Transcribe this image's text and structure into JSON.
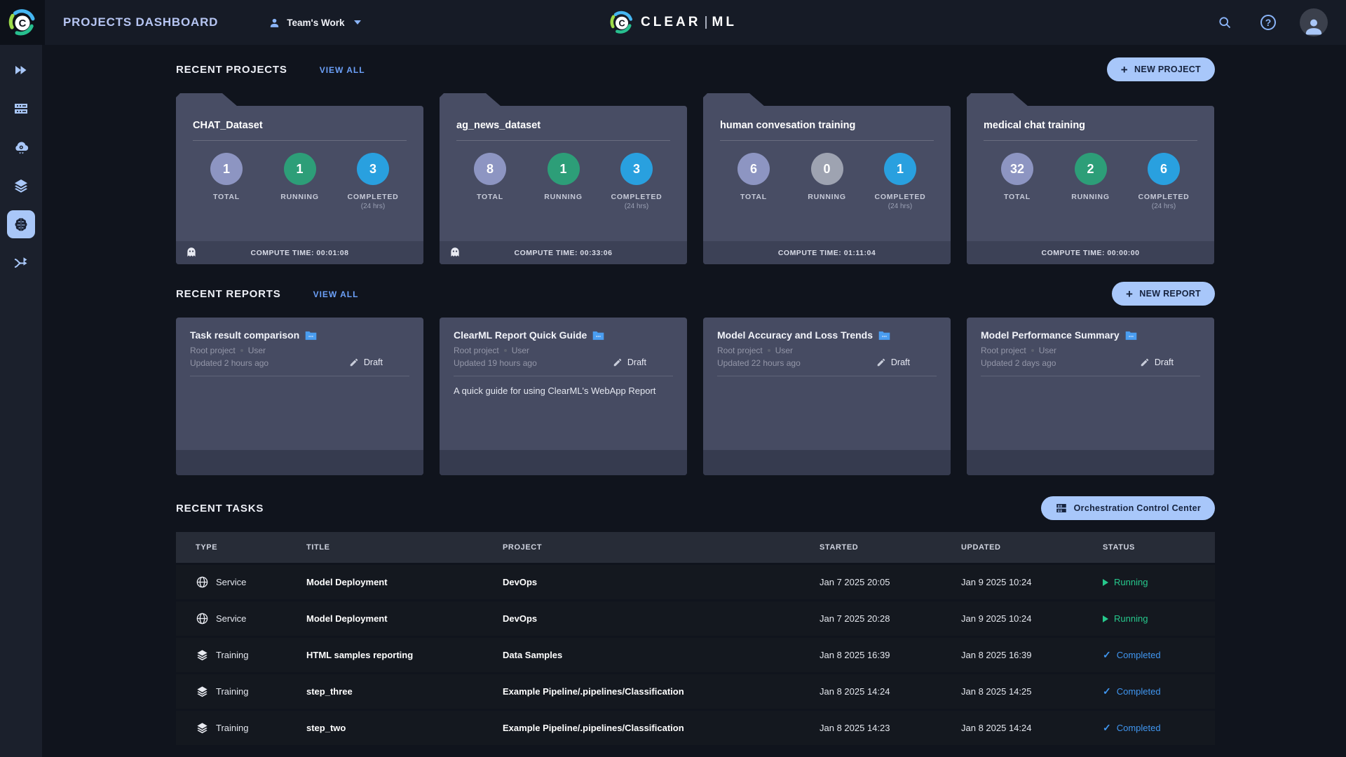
{
  "colors": {
    "accent_blue": "#a8c7fa",
    "link_blue": "#6ca0f8",
    "running_green": "#26c88c",
    "completed_blue": "#4096f0",
    "circle_total": "#8d95c2",
    "circle_running": "#2d9e78",
    "circle_completed": "#29a0df",
    "circle_zero": "#9ea3b1",
    "card_bg": "#484d64",
    "card_footer_bg": "#3c4156",
    "header_bg": "#161b26",
    "page_bg": "#10141d"
  },
  "header": {
    "page_title": "PROJECTS DASHBOARD",
    "workspace_label": "Team's Work",
    "brand_left": "CLEAR",
    "brand_right": "ML"
  },
  "icons": {
    "header": [
      "clearml-logo-icon",
      "user-icon",
      "chevron-down-icon",
      "search-icon",
      "help-icon",
      "profile-icon"
    ],
    "sidebar": [
      "getting-started-icon",
      "workers-queues-icon",
      "cloud-autoscaler-icon",
      "datasets-icon",
      "projects-brain-icon",
      "pipelines-icon"
    ],
    "misc": [
      "folder-tab",
      "ghost-icon",
      "report-folder-icon",
      "pencil-icon",
      "plus-icon",
      "globe-icon",
      "layers-icon",
      "play-icon",
      "check-icon",
      "server-icon"
    ]
  },
  "recent_projects": {
    "title": "RECENT PROJECTS",
    "view_all": "VIEW ALL",
    "new_button": "NEW PROJECT",
    "stats_labels": {
      "total": "TOTAL",
      "running": "RUNNING",
      "completed": "COMPLETED",
      "completed_sub": "(24 hrs)"
    },
    "cards": [
      {
        "name": "CHAT_Dataset",
        "total": "1",
        "running": "1",
        "completed": "3",
        "compute_time": "COMPUTE TIME: 00:01:08",
        "ghost": true
      },
      {
        "name": "ag_news_dataset",
        "total": "8",
        "running": "1",
        "completed": "3",
        "compute_time": "COMPUTE TIME: 00:33:06",
        "ghost": true
      },
      {
        "name": "human convesation training",
        "total": "6",
        "running": "0",
        "completed": "1",
        "compute_time": "COMPUTE TIME: 01:11:04",
        "ghost": false
      },
      {
        "name": "medical chat training",
        "total": "32",
        "running": "2",
        "completed": "6",
        "compute_time": "COMPUTE TIME: 00:00:00",
        "ghost": false
      }
    ]
  },
  "recent_reports": {
    "title": "RECENT REPORTS",
    "view_all": "VIEW ALL",
    "new_button": "NEW REPORT",
    "cards": [
      {
        "title": "Task result comparison",
        "project": "Root project",
        "author": "User",
        "updated": "Updated 2 hours ago",
        "status": "Draft",
        "description": ""
      },
      {
        "title": "ClearML Report Quick Guide",
        "project": "Root project",
        "author": "User",
        "updated": "Updated 19 hours ago",
        "status": "Draft",
        "description": "A quick guide for using ClearML's WebApp Report"
      },
      {
        "title": "Model Accuracy and Loss Trends",
        "project": "Root project",
        "author": "User",
        "updated": "Updated 22 hours ago",
        "status": "Draft",
        "description": ""
      },
      {
        "title": "Model Performance Summary",
        "project": "Root project",
        "author": "User",
        "updated": "Updated 2 days ago",
        "status": "Draft",
        "description": ""
      }
    ]
  },
  "recent_tasks": {
    "title": "RECENT TASKS",
    "orchestration_button": "Orchestration Control Center",
    "columns": {
      "type": "TYPE",
      "title": "TITLE",
      "project": "PROJECT",
      "started": "STARTED",
      "updated": "UPDATED",
      "status": "STATUS"
    },
    "rows": [
      {
        "type": "Service",
        "title": "Model Deployment",
        "project": "DevOps",
        "started": "Jan 7 2025 20:05",
        "updated": "Jan 9 2025 10:24",
        "status": "Running"
      },
      {
        "type": "Service",
        "title": "Model Deployment",
        "project": "DevOps",
        "started": "Jan 7 2025 20:28",
        "updated": "Jan 9 2025 10:24",
        "status": "Running"
      },
      {
        "type": "Training",
        "title": "HTML samples reporting",
        "project": "Data Samples",
        "started": "Jan 8 2025 16:39",
        "updated": "Jan 8 2025 16:39",
        "status": "Completed"
      },
      {
        "type": "Training",
        "title": "step_three",
        "project": "Example Pipeline/.pipelines/Classification",
        "started": "Jan 8 2025 14:24",
        "updated": "Jan 8 2025 14:25",
        "status": "Completed"
      },
      {
        "type": "Training",
        "title": "step_two",
        "project": "Example Pipeline/.pipelines/Classification",
        "started": "Jan 8 2025 14:23",
        "updated": "Jan 8 2025 14:24",
        "status": "Completed"
      }
    ]
  }
}
